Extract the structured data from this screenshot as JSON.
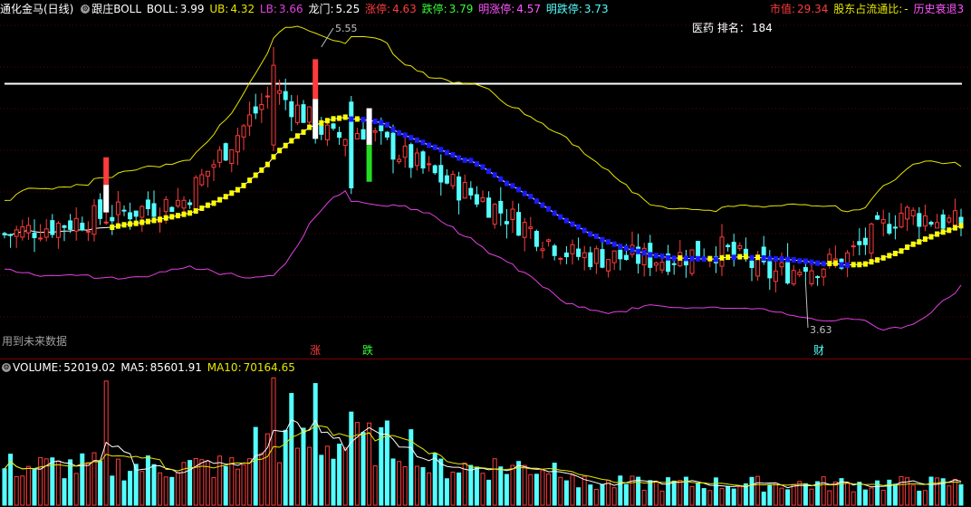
{
  "header": {
    "stock_name": "通化金马(日线)",
    "indicator_label": "跟庄BOLL",
    "boll_label": "BOLL:",
    "boll_value": "3.99",
    "ub_label": "UB:",
    "ub_value": "4.32",
    "lb_label": "LB:",
    "lb_value": "3.66",
    "longmen_label": "龙门:",
    "longmen_value": "5.25",
    "zhangting_label": "涨停:",
    "zhangting_value": "4.63",
    "dieting_label": "跌停:",
    "dieting_value": "3.79",
    "ming_zhangting_label": "明涨停:",
    "ming_zhangting_value": "4.57",
    "ming_dieting_label": "明跌停:",
    "ming_dieting_value": "3.73",
    "market_value_label": "市值:",
    "market_value": "29.34",
    "float_ratio_label": "股东占流通比:",
    "float_ratio_value": "-",
    "history_label": "历史衰退3"
  },
  "rank": {
    "label": "医药 排名：",
    "value": "184"
  },
  "future_note": "用到未来数据",
  "markers": {
    "zhang": "涨",
    "die": "跌",
    "cai": "财"
  },
  "price_annotations": {
    "high": "5.55",
    "low": "3.63"
  },
  "volume_header": {
    "volume_label": "VOLUME:",
    "volume_value": "52019.02",
    "ma5_label": "MA5:",
    "ma5_value": "85601.91",
    "ma10_label": "MA10:",
    "ma10_value": "70164.65"
  },
  "colors": {
    "up": "#ff3b3b",
    "down": "#54ffff",
    "ub": "#e6e600",
    "lb": "#e040e0",
    "mid": "#ffffff",
    "dot_up": "#ffff00",
    "dot_down": "#1a1aff",
    "longmen": "#ffffff"
  },
  "chart_data": {
    "type": "candlestick",
    "price_range": [
      3.2,
      5.8
    ],
    "longmen_level": 5.25,
    "annotated_high": 5.55,
    "annotated_low": 3.63,
    "seed": [
      [
        4.1,
        4.0,
        4.2,
        3.9
      ],
      [
        4.0,
        4.35,
        4.4,
        3.98
      ]
    ],
    "key_points": [
      [
        0,
        4.02
      ],
      [
        20,
        4.2
      ],
      [
        30,
        4.3
      ],
      [
        45,
        5.2
      ],
      [
        55,
        4.8
      ],
      [
        60,
        4.88
      ],
      [
        70,
        4.55
      ],
      [
        80,
        4.3
      ],
      [
        95,
        3.85
      ],
      [
        110,
        3.82
      ],
      [
        120,
        3.9
      ],
      [
        128,
        3.7
      ],
      [
        140,
        3.8
      ],
      [
        150,
        4.2
      ],
      [
        160,
        4.1
      ]
    ],
    "volume_max": 210000
  }
}
